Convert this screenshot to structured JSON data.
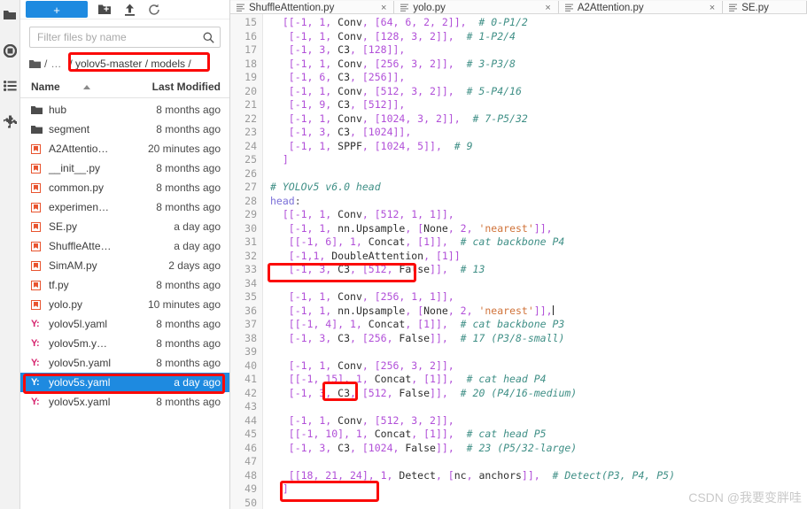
{
  "rail": {
    "items": [
      {
        "name": "folder-icon",
        "label": "Files"
      },
      {
        "name": "running-icon",
        "label": "Running"
      },
      {
        "name": "commands-icon",
        "label": "Commands"
      },
      {
        "name": "extensions-icon",
        "label": "Extensions"
      }
    ]
  },
  "browser": {
    "toolbar": {
      "new_label": "+",
      "new_folder_icon": "new-folder-icon",
      "upload_icon": "upload-icon",
      "refresh_icon": "refresh-icon"
    },
    "filter": {
      "placeholder": "Filter files by name",
      "value": "",
      "search_icon": "search-icon"
    },
    "breadcrumb": {
      "home_icon": "folder-icon",
      "sep": "/",
      "ellipsis": "…",
      "path": "/ yolov5-master / models /",
      "highlight_color": "#fb0a08"
    },
    "columns": {
      "name": "Name",
      "last_modified": "Last Modified"
    },
    "files": [
      {
        "icon": "folder-icon",
        "name": "hub",
        "modified": "8 months ago",
        "selected": false
      },
      {
        "icon": "folder-icon",
        "name": "segment",
        "modified": "8 months ago",
        "selected": false
      },
      {
        "icon": "python-icon",
        "name": "A2Attentio…",
        "modified": "20 minutes ago",
        "selected": false
      },
      {
        "icon": "python-icon",
        "name": "__init__.py",
        "modified": "8 months ago",
        "selected": false
      },
      {
        "icon": "python-icon",
        "name": "common.py",
        "modified": "8 months ago",
        "selected": false
      },
      {
        "icon": "python-icon",
        "name": "experimen…",
        "modified": "8 months ago",
        "selected": false
      },
      {
        "icon": "python-icon",
        "name": "SE.py",
        "modified": "a day ago",
        "selected": false
      },
      {
        "icon": "python-icon",
        "name": "ShuffleAtte…",
        "modified": "a day ago",
        "selected": false
      },
      {
        "icon": "python-icon",
        "name": "SimAM.py",
        "modified": "2 days ago",
        "selected": false
      },
      {
        "icon": "python-icon",
        "name": "tf.py",
        "modified": "8 months ago",
        "selected": false
      },
      {
        "icon": "python-icon",
        "name": "yolo.py",
        "modified": "10 minutes ago",
        "selected": false
      },
      {
        "icon": "yaml-icon",
        "name": "yolov5l.yaml",
        "modified": "8 months ago",
        "selected": false
      },
      {
        "icon": "yaml-icon",
        "name": "yolov5m.y…",
        "modified": "8 months ago",
        "selected": false
      },
      {
        "icon": "yaml-icon",
        "name": "yolov5n.yaml",
        "modified": "8 months ago",
        "selected": false
      },
      {
        "icon": "yaml-icon",
        "name": "yolov5s.yaml",
        "modified": "a day ago",
        "selected": true
      },
      {
        "icon": "yaml-icon",
        "name": "yolov5x.yaml",
        "modified": "8 months ago",
        "selected": false
      }
    ]
  },
  "editor": {
    "tabs": [
      {
        "label": "ShuffleAttention.py",
        "close": "×",
        "active": false
      },
      {
        "label": "yolo.py",
        "close": "×",
        "active": false
      },
      {
        "label": "A2Attention.py",
        "close": "×",
        "active": false
      },
      {
        "label": "SE.py",
        "close": "",
        "active": true
      }
    ],
    "first_line_number": 15,
    "lines": [
      {
        "n": 15,
        "tokens": [
          {
            "t": "brk",
            "v": "  [[-1, 1, "
          },
          {
            "t": "id",
            "v": "Conv"
          },
          {
            "t": "brk",
            "v": ", [64, 6, 2, 2]],"
          },
          {
            "t": "com",
            "v": "  # 0-P1/2"
          }
        ]
      },
      {
        "n": 16,
        "tokens": [
          {
            "t": "brk",
            "v": "   [-1, 1, "
          },
          {
            "t": "id",
            "v": "Conv"
          },
          {
            "t": "brk",
            "v": ", [128, 3, 2]],"
          },
          {
            "t": "com",
            "v": "  # 1-P2/4"
          }
        ]
      },
      {
        "n": 17,
        "tokens": [
          {
            "t": "brk",
            "v": "   [-1, 3, "
          },
          {
            "t": "id",
            "v": "C3"
          },
          {
            "t": "brk",
            "v": ", [128]],"
          }
        ]
      },
      {
        "n": 18,
        "tokens": [
          {
            "t": "brk",
            "v": "   [-1, 1, "
          },
          {
            "t": "id",
            "v": "Conv"
          },
          {
            "t": "brk",
            "v": ", [256, 3, 2]],"
          },
          {
            "t": "com",
            "v": "  # 3-P3/8"
          }
        ]
      },
      {
        "n": 19,
        "tokens": [
          {
            "t": "brk",
            "v": "   [-1, 6, "
          },
          {
            "t": "id",
            "v": "C3"
          },
          {
            "t": "brk",
            "v": ", [256]],"
          }
        ]
      },
      {
        "n": 20,
        "tokens": [
          {
            "t": "brk",
            "v": "   [-1, 1, "
          },
          {
            "t": "id",
            "v": "Conv"
          },
          {
            "t": "brk",
            "v": ", [512, 3, 2]],"
          },
          {
            "t": "com",
            "v": "  # 5-P4/16"
          }
        ]
      },
      {
        "n": 21,
        "tokens": [
          {
            "t": "brk",
            "v": "   [-1, 9, "
          },
          {
            "t": "id",
            "v": "C3"
          },
          {
            "t": "brk",
            "v": ", [512]],"
          }
        ]
      },
      {
        "n": 22,
        "tokens": [
          {
            "t": "brk",
            "v": "   [-1, 1, "
          },
          {
            "t": "id",
            "v": "Conv"
          },
          {
            "t": "brk",
            "v": ", [1024, 3, 2]],"
          },
          {
            "t": "com",
            "v": "  # 7-P5/32"
          }
        ]
      },
      {
        "n": 23,
        "tokens": [
          {
            "t": "brk",
            "v": "   [-1, 3, "
          },
          {
            "t": "id",
            "v": "C3"
          },
          {
            "t": "brk",
            "v": ", [1024]],"
          }
        ]
      },
      {
        "n": 24,
        "tokens": [
          {
            "t": "brk",
            "v": "   [-1, 1, "
          },
          {
            "t": "id",
            "v": "SPPF"
          },
          {
            "t": "brk",
            "v": ", [1024, 5]],"
          },
          {
            "t": "com",
            "v": "  # 9"
          }
        ]
      },
      {
        "n": 25,
        "tokens": [
          {
            "t": "brk",
            "v": "  ]"
          }
        ]
      },
      {
        "n": 26,
        "tokens": []
      },
      {
        "n": 27,
        "tokens": [
          {
            "t": "com",
            "v": "# YOLOv5 v6.0 head"
          }
        ]
      },
      {
        "n": 28,
        "tokens": [
          {
            "t": "key",
            "v": "head"
          },
          {
            "t": "pun",
            "v": ":"
          }
        ]
      },
      {
        "n": 29,
        "tokens": [
          {
            "t": "brk",
            "v": "  [[-1, 1, "
          },
          {
            "t": "id",
            "v": "Conv"
          },
          {
            "t": "brk",
            "v": ", [512, 1, 1]],"
          }
        ]
      },
      {
        "n": 30,
        "tokens": [
          {
            "t": "brk",
            "v": "   [-1, 1, "
          },
          {
            "t": "id",
            "v": "nn.Upsample"
          },
          {
            "t": "brk",
            "v": ", ["
          },
          {
            "t": "id",
            "v": "None"
          },
          {
            "t": "brk",
            "v": ", 2, "
          },
          {
            "t": "str",
            "v": "'nearest'"
          },
          {
            "t": "brk",
            "v": "]],"
          }
        ]
      },
      {
        "n": 31,
        "tokens": [
          {
            "t": "brk",
            "v": "   [[-1, 6], 1, "
          },
          {
            "t": "id",
            "v": "Concat"
          },
          {
            "t": "brk",
            "v": ", [1]],"
          },
          {
            "t": "com",
            "v": "  # cat backbone P4"
          }
        ]
      },
      {
        "n": 32,
        "tokens": [
          {
            "t": "brk",
            "v": "   [-1,1, "
          },
          {
            "t": "id",
            "v": "DoubleAttention"
          },
          {
            "t": "brk",
            "v": ", [1]]"
          }
        ]
      },
      {
        "n": 33,
        "tokens": [
          {
            "t": "brk",
            "v": "   [-1, 3, "
          },
          {
            "t": "id",
            "v": "C3"
          },
          {
            "t": "brk",
            "v": ", [512, "
          },
          {
            "t": "id",
            "v": "False"
          },
          {
            "t": "brk",
            "v": "]],"
          },
          {
            "t": "com",
            "v": "  # 13"
          }
        ]
      },
      {
        "n": 34,
        "tokens": []
      },
      {
        "n": 35,
        "tokens": [
          {
            "t": "brk",
            "v": "   [-1, 1, "
          },
          {
            "t": "id",
            "v": "Conv"
          },
          {
            "t": "brk",
            "v": ", [256, 1, 1]],"
          }
        ]
      },
      {
        "n": 36,
        "tokens": [
          {
            "t": "brk",
            "v": "   [-1, 1, "
          },
          {
            "t": "id",
            "v": "nn.Upsample"
          },
          {
            "t": "brk",
            "v": ", ["
          },
          {
            "t": "id",
            "v": "None"
          },
          {
            "t": "brk",
            "v": ", 2, "
          },
          {
            "t": "str",
            "v": "'nearest'"
          },
          {
            "t": "brk",
            "v": "]],"
          },
          {
            "t": "caret",
            "v": ""
          }
        ]
      },
      {
        "n": 37,
        "tokens": [
          {
            "t": "brk",
            "v": "   [[-1, 4], 1, "
          },
          {
            "t": "id",
            "v": "Concat"
          },
          {
            "t": "brk",
            "v": ", [1]],"
          },
          {
            "t": "com",
            "v": "  # cat backbone P3"
          }
        ]
      },
      {
        "n": 38,
        "tokens": [
          {
            "t": "brk",
            "v": "   [-1, 3, "
          },
          {
            "t": "id",
            "v": "C3"
          },
          {
            "t": "brk",
            "v": ", [256, "
          },
          {
            "t": "id",
            "v": "False"
          },
          {
            "t": "brk",
            "v": "]],"
          },
          {
            "t": "com",
            "v": "  # 17 (P3/8-small)"
          }
        ]
      },
      {
        "n": 39,
        "tokens": []
      },
      {
        "n": 40,
        "tokens": [
          {
            "t": "brk",
            "v": "   [-1, 1, "
          },
          {
            "t": "id",
            "v": "Conv"
          },
          {
            "t": "brk",
            "v": ", [256, 3, 2]],"
          }
        ]
      },
      {
        "n": 41,
        "tokens": [
          {
            "t": "brk",
            "v": "   [[-1, 15], 1, "
          },
          {
            "t": "id",
            "v": "Concat"
          },
          {
            "t": "brk",
            "v": ", [1]],"
          },
          {
            "t": "com",
            "v": "  # cat head P4"
          }
        ]
      },
      {
        "n": 42,
        "tokens": [
          {
            "t": "brk",
            "v": "   [-1, 3, "
          },
          {
            "t": "id",
            "v": "C3"
          },
          {
            "t": "brk",
            "v": ", [512, "
          },
          {
            "t": "id",
            "v": "False"
          },
          {
            "t": "brk",
            "v": "]],"
          },
          {
            "t": "com",
            "v": "  # 20 (P4/16-medium)"
          }
        ]
      },
      {
        "n": 43,
        "tokens": []
      },
      {
        "n": 44,
        "tokens": [
          {
            "t": "brk",
            "v": "   [-1, 1, "
          },
          {
            "t": "id",
            "v": "Conv"
          },
          {
            "t": "brk",
            "v": ", [512, 3, 2]],"
          }
        ]
      },
      {
        "n": 45,
        "tokens": [
          {
            "t": "brk",
            "v": "   [[-1, 10], 1, "
          },
          {
            "t": "id",
            "v": "Concat"
          },
          {
            "t": "brk",
            "v": ", [1]],"
          },
          {
            "t": "com",
            "v": "  # cat head P5"
          }
        ]
      },
      {
        "n": 46,
        "tokens": [
          {
            "t": "brk",
            "v": "   [-1, 3, "
          },
          {
            "t": "id",
            "v": "C3"
          },
          {
            "t": "brk",
            "v": ", [1024, "
          },
          {
            "t": "id",
            "v": "False"
          },
          {
            "t": "brk",
            "v": "]],"
          },
          {
            "t": "com",
            "v": "  # 23 (P5/32-large)"
          }
        ]
      },
      {
        "n": 47,
        "tokens": []
      },
      {
        "n": 48,
        "tokens": [
          {
            "t": "brk",
            "v": "   [[18, 21, 24], 1, "
          },
          {
            "t": "id",
            "v": "Detect"
          },
          {
            "t": "brk",
            "v": ", ["
          },
          {
            "t": "id",
            "v": "nc"
          },
          {
            "t": "brk",
            "v": ", "
          },
          {
            "t": "id",
            "v": "anchors"
          },
          {
            "t": "brk",
            "v": "]],"
          },
          {
            "t": "com",
            "v": "  # Detect(P3, P4, P5)"
          }
        ]
      },
      {
        "n": 49,
        "tokens": [
          {
            "t": "brk",
            "v": "  ]"
          }
        ]
      },
      {
        "n": 50,
        "tokens": []
      }
    ],
    "annotations": [
      {
        "name": "double-attention-highlight",
        "line": 32,
        "label": "DoubleAttention, [1]]"
      },
      {
        "name": "concat-index-highlight",
        "line": 41,
        "label": "15]"
      },
      {
        "name": "detect-indices-highlight",
        "line": 48,
        "label": "[[18, 21, 24]"
      }
    ]
  },
  "watermark": {
    "text": "CSDN @我要变胖哇"
  }
}
